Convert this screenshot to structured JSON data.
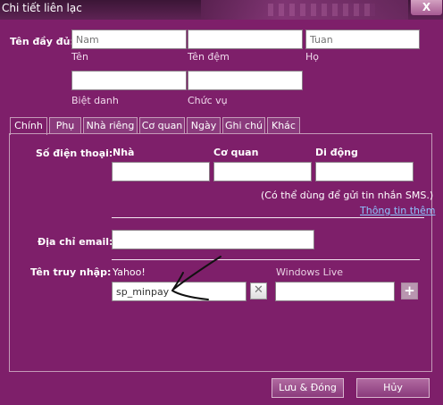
{
  "window": {
    "title": "Chi tiết liên lạc",
    "close_label": "X"
  },
  "name": {
    "full_name_label": "Tên đầy đủ:",
    "first_placeholder": "Nam",
    "first_sub": "Tên",
    "middle_placeholder": "",
    "middle_sub": "Tên đệm",
    "last_placeholder": "Tuan",
    "last_sub": "Họ",
    "nickname_sub": "Biệt danh",
    "title_sub": "Chức vụ"
  },
  "tabs": [
    {
      "label": "Chính"
    },
    {
      "label": "Phụ"
    },
    {
      "label": "Nhà riêng"
    },
    {
      "label": "Cơ quan"
    },
    {
      "label": "Ngày"
    },
    {
      "label": "Ghi chú"
    },
    {
      "label": "Khác"
    }
  ],
  "phone": {
    "label": "Số điện thoại:",
    "home": "Nhà",
    "work": "Cơ quan",
    "mobile": "Di động",
    "sms_note": "(Có thể dùng để gửi tin nhắn SMS.)",
    "more_info": "Thông tin thêm"
  },
  "email": {
    "label": "Địa chỉ email:",
    "value": ""
  },
  "login": {
    "label": "Tên truy nhập:",
    "yahoo_label": "Yahoo!",
    "yahoo_value": "sp_minpay",
    "clear_label": "✕",
    "windows_live_label": "Windows Live",
    "windows_live_value": "",
    "add_label": "+"
  },
  "footer": {
    "save_label": "Lưu & Đóng",
    "cancel_label": "Hủy"
  },
  "colors": {
    "background": "#7e1f6a",
    "accent_link": "#8ec3ff"
  }
}
